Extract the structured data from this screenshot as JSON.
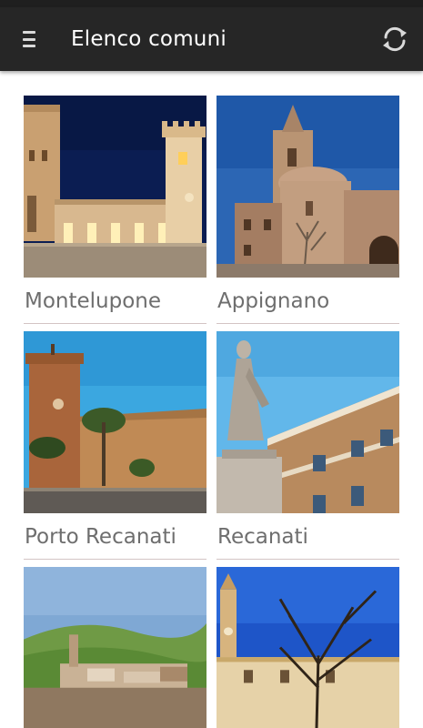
{
  "app": {
    "title": "Elenco comuni",
    "menu_icon": "hamburger-menu-icon",
    "refresh_icon": "refresh-icon"
  },
  "towns": [
    {
      "name": "Montelupone"
    },
    {
      "name": "Appignano"
    },
    {
      "name": "Porto Recanati"
    },
    {
      "name": "Recanati"
    },
    {
      "name": ""
    },
    {
      "name": ""
    }
  ]
}
